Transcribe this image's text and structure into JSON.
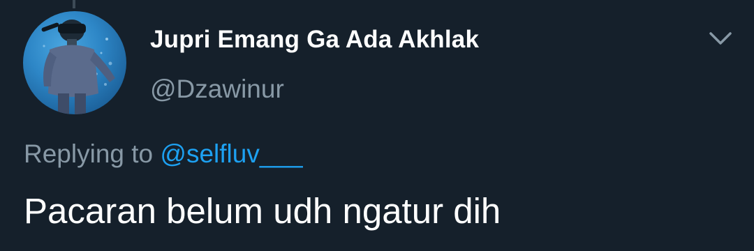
{
  "author": {
    "display_name": "Jupri Emang Ga Ada Akhlak",
    "handle": "@Dzawinur",
    "avatar_icon": "user-avatar-diver-photo"
  },
  "menu": {
    "icon": "chevron-down-icon"
  },
  "reply": {
    "prefix": "Replying to",
    "mention": "@selfluv___"
  },
  "tweet": {
    "text": "Pacaran belum udh ngatur dih"
  },
  "colors": {
    "background": "#15202b",
    "primary_text": "#ffffff",
    "secondary_text": "#8899a6",
    "link": "#1da1f2"
  }
}
